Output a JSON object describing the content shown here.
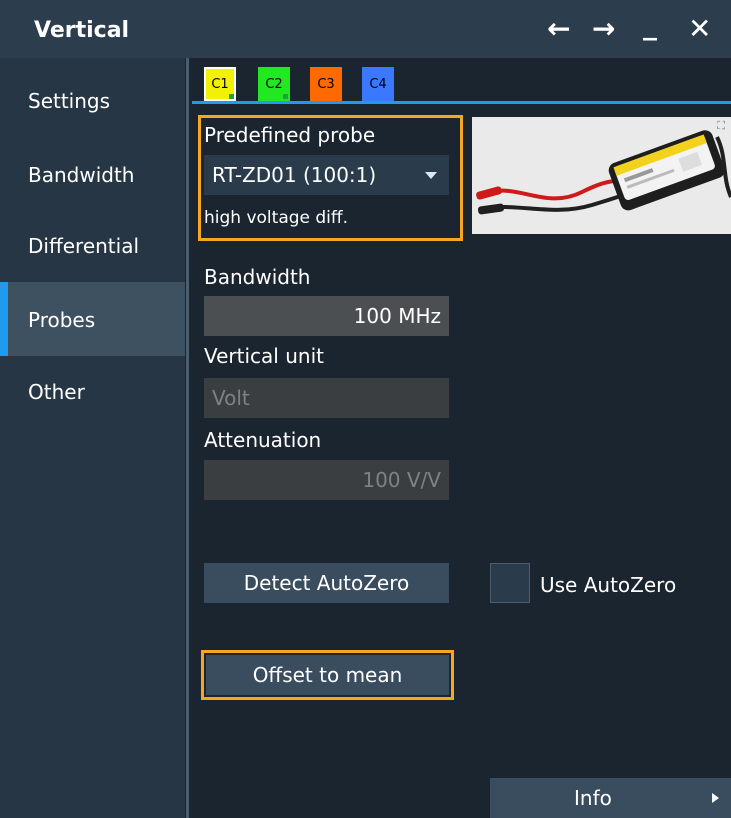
{
  "window": {
    "title": "Vertical",
    "controls": {
      "back": "←",
      "forward": "→",
      "minimize": "_",
      "close": "✕"
    }
  },
  "sidebar": {
    "items": [
      {
        "label": "Settings"
      },
      {
        "label": "Bandwidth"
      },
      {
        "label": "Differential"
      },
      {
        "label": "Probes",
        "active": true
      },
      {
        "label": "Other"
      }
    ]
  },
  "channel_tabs": [
    {
      "label": "C1",
      "color": "#f2f200",
      "selected": true
    },
    {
      "label": "C2",
      "color": "#22e822"
    },
    {
      "label": "C3",
      "color": "#ff6a00"
    },
    {
      "label": "C4",
      "color": "#3a78ff"
    }
  ],
  "probe": {
    "predefined_label": "Predefined probe",
    "predefined_value": "RT-ZD01 (100:1)",
    "description": "high voltage diff.",
    "image_icon": "probe-photo"
  },
  "bandwidth": {
    "label": "Bandwidth",
    "value": "100 MHz"
  },
  "vertical_unit": {
    "label": "Vertical unit",
    "value": "Volt"
  },
  "attenuation": {
    "label": "Attenuation",
    "value": "100 V/V"
  },
  "buttons": {
    "detect_autozero": "Detect AutoZero",
    "use_autozero": "Use AutoZero",
    "offset_to_mean": "Offset to mean",
    "info": "Info"
  },
  "colors": {
    "accent": "#1f9aee",
    "highlight": "#f5a623"
  }
}
